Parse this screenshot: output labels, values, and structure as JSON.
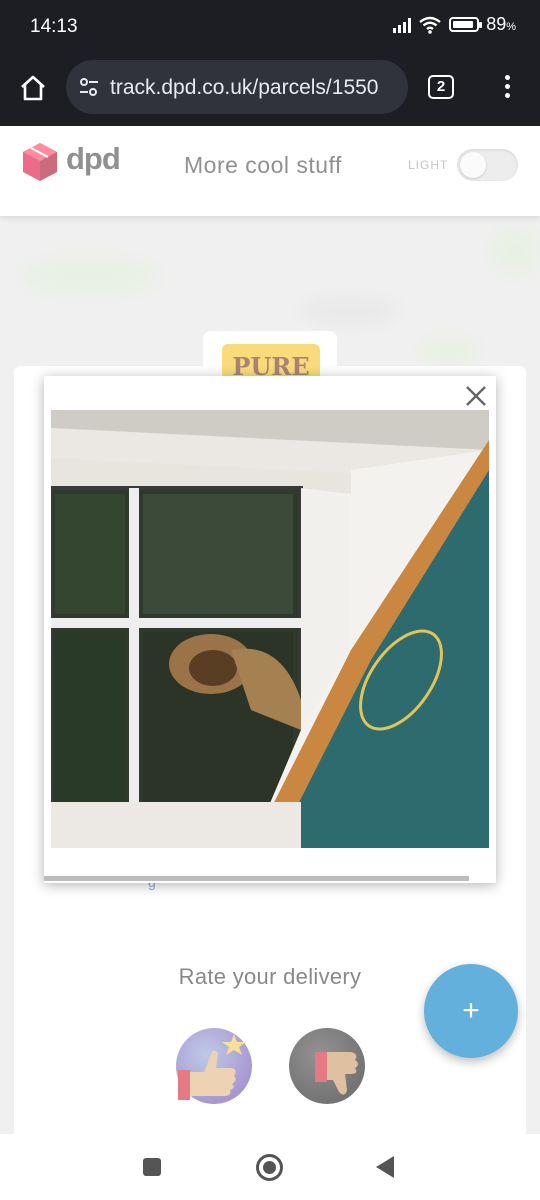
{
  "status_bar": {
    "time": "14:13",
    "battery_percent": "89",
    "battery_unit": "%",
    "battery_level": 0.89
  },
  "browser": {
    "url": "track.dpd.co.uk/parcels/1550",
    "tab_count": "2",
    "icons": [
      "home-icon",
      "tune-icon",
      "tabs-icon",
      "more-vert-icon"
    ]
  },
  "header": {
    "logo_text": "dpd",
    "title": "More cool stuff",
    "theme_label": "LIGHT",
    "brand_color": "#dc0032"
  },
  "background": {
    "brand_badge_text": "PURE",
    "rate_label": "Rate your delivery",
    "rate_buttons": [
      "thumbs-up-icon",
      "thumbs-down-icon"
    ],
    "fab_label": "+",
    "fab_color": "#4aa3d6"
  },
  "modal": {
    "image_subject": "delivery-photo",
    "close_icon": "close-icon",
    "progress": 0.94
  },
  "nav": {
    "icons": [
      "recents-icon",
      "home-icon",
      "back-icon"
    ]
  }
}
